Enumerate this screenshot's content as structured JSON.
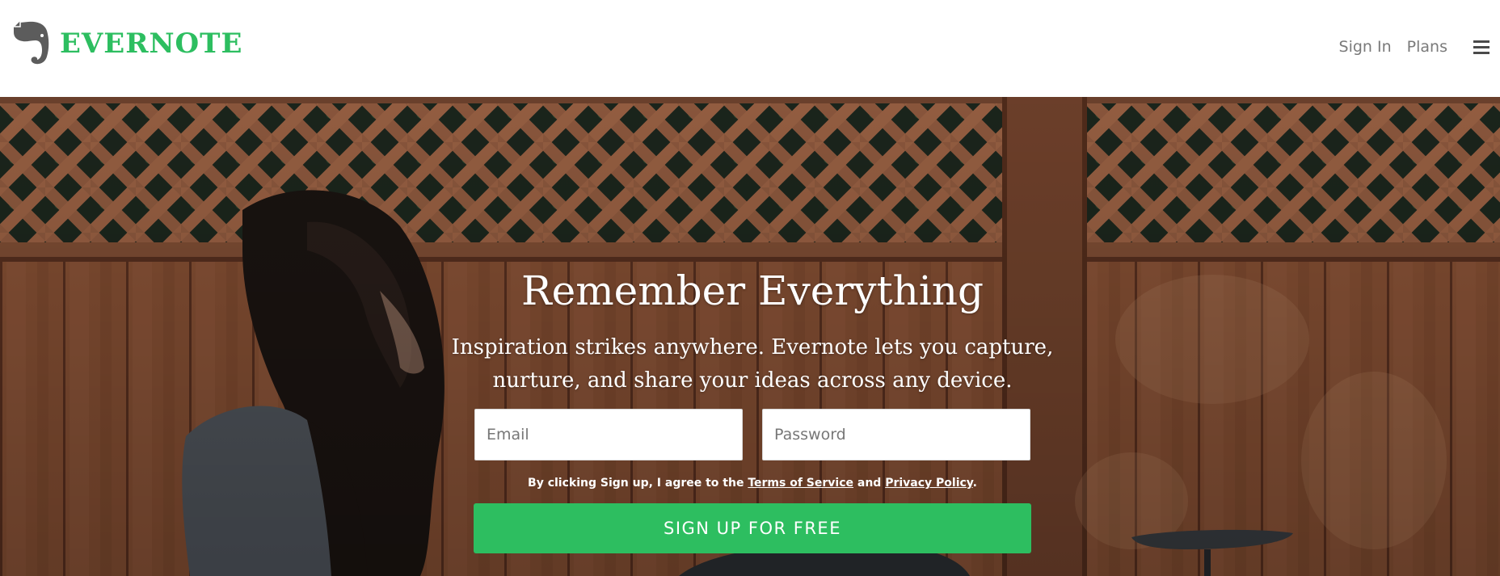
{
  "header": {
    "logo_text": "EVERNOTE",
    "nav": {
      "sign_in": "Sign In",
      "plans": "Plans"
    },
    "menu_icon": "hamburger-menu-icon"
  },
  "hero": {
    "title": "Remember Everything",
    "subtitle_line1": "Inspiration strikes anywhere. Evernote lets you capture,",
    "subtitle_line2": "nurture, and share your ideas across any device.",
    "email_placeholder": "Email",
    "password_placeholder": "Password",
    "terms": {
      "prefix": "By clicking Sign up, I agree to the ",
      "tos_link": "Terms of Service",
      "middle": " and ",
      "privacy_link": "Privacy Policy",
      "suffix": "."
    },
    "signup_label": "SIGN UP FOR FREE"
  },
  "colors": {
    "brand_green": "#2dbe60",
    "nav_text": "#7a7a7a",
    "hero_text": "#ffffff"
  }
}
